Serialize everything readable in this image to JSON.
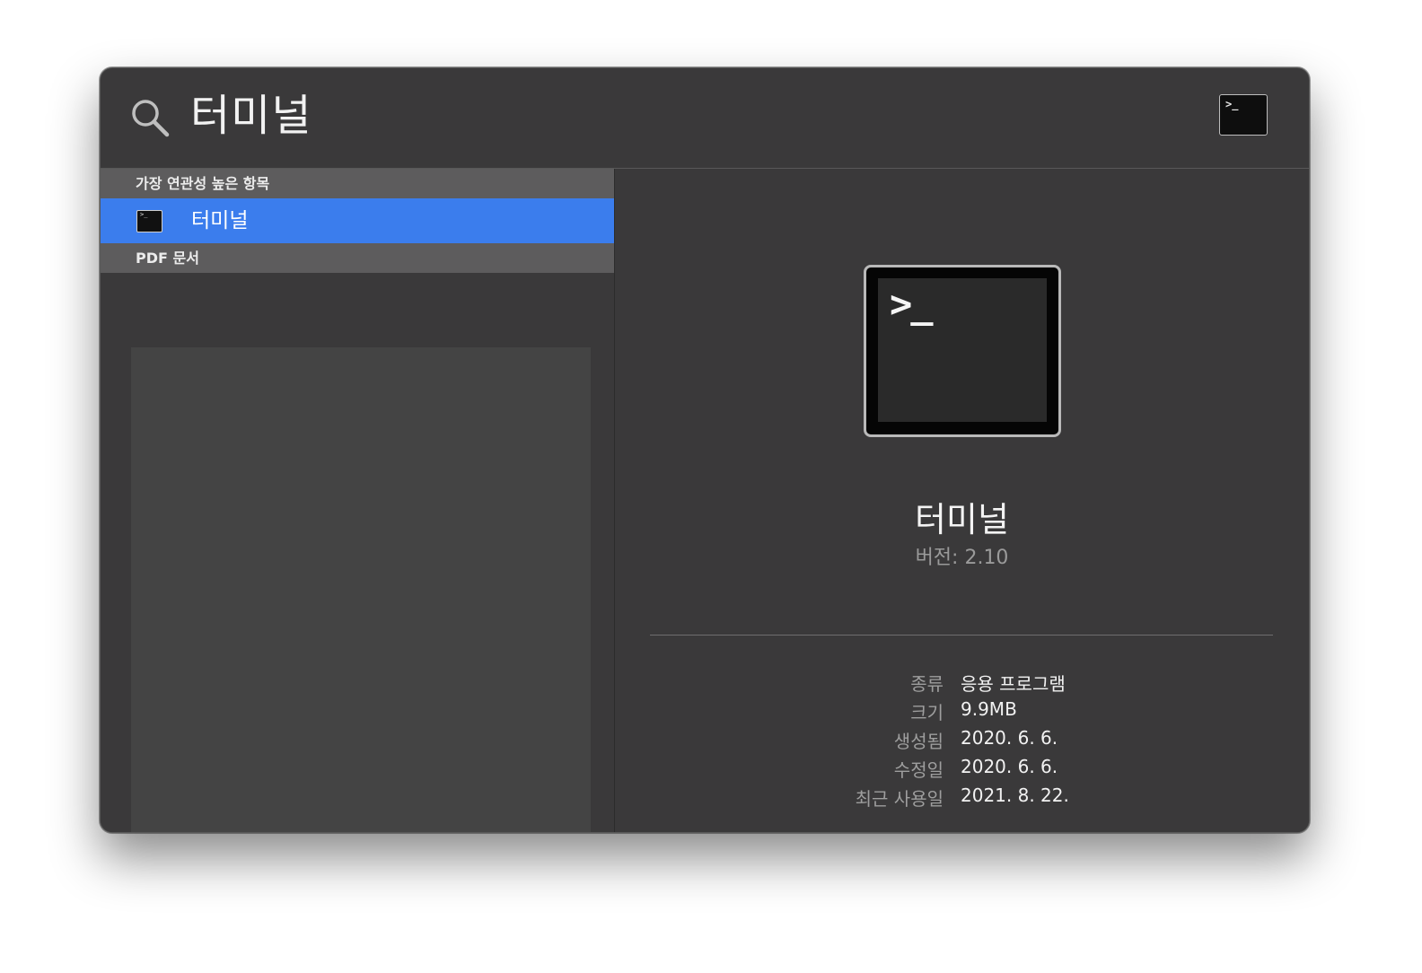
{
  "search": {
    "query": "터미널",
    "icon": "search-icon",
    "top_result_icon": "terminal-icon",
    "prompt_glyph": ">_"
  },
  "results": {
    "sections": [
      {
        "header": "가장 연관성 높은 항목",
        "items": [
          {
            "label": "터미널",
            "icon": "terminal-icon",
            "selected": true
          }
        ]
      },
      {
        "header": "PDF 문서",
        "items": []
      }
    ]
  },
  "detail": {
    "app_name": "터미널",
    "version": "버전: 2.10",
    "icon": "terminal-icon",
    "metadata": [
      {
        "key": "종류",
        "value": "응용 프로그램"
      },
      {
        "key": "크기",
        "value": "9.9MB"
      },
      {
        "key": "생성됨",
        "value": "2020. 6. 6."
      },
      {
        "key": "수정일",
        "value": "2020. 6. 6."
      },
      {
        "key": "최근 사용일",
        "value": "2021. 8. 22."
      }
    ]
  },
  "colors": {
    "selection": "#3b7ded",
    "window_bg": "#3a393a",
    "section_header_bg": "#5d5c5d"
  }
}
